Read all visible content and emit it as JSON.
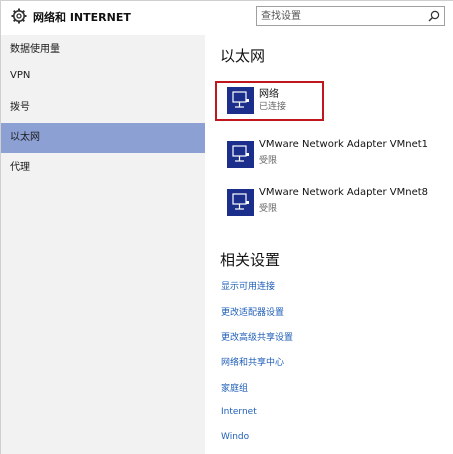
{
  "header": {
    "title": "网络和 INTERNET",
    "search_placeholder": "查找设置",
    "gear_icon": "gear-icon",
    "search_icon": "search-icon"
  },
  "sidebar": {
    "items": [
      {
        "label": "数据使用量",
        "selected": false
      },
      {
        "label": "VPN",
        "selected": false
      },
      {
        "label": "拨号",
        "selected": false
      },
      {
        "label": "以太网",
        "selected": true
      },
      {
        "label": "代理",
        "selected": false
      }
    ],
    "selected_color": "#8da0d4"
  },
  "main": {
    "title": "以太网",
    "networks": [
      {
        "name": "网络",
        "status": "已连接",
        "icon": "network-adapter-icon"
      },
      {
        "name": "VMware Network Adapter VMnet1",
        "status": "受限",
        "icon": "network-adapter-icon"
      },
      {
        "name": "VMware Network Adapter VMnet8",
        "status": "受限",
        "icon": "network-adapter-icon"
      }
    ],
    "related_title": "相关设置",
    "related_links": [
      "显示可用连接",
      "更改适配器设置",
      "更改高级共享设置",
      "网络和共享中心",
      "家庭组",
      "Internet",
      "Windo"
    ],
    "link_color": "#1f5fb8",
    "highlight_color": "#c0161d",
    "icon_color": "#1b2e8c"
  }
}
